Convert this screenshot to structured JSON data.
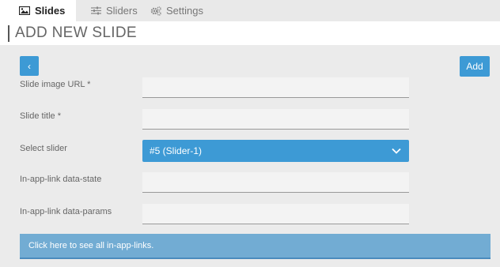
{
  "tabs": [
    {
      "label": "Slides",
      "icon": "image-icon",
      "active": true
    },
    {
      "label": "Sliders",
      "icon": "sliders-icon",
      "active": false
    },
    {
      "label": "Settings",
      "icon": "gears-icon",
      "active": false
    }
  ],
  "page": {
    "title": "ADD NEW SLIDE"
  },
  "toolbar": {
    "back_label": "‹",
    "add_label": "Add"
  },
  "form": {
    "image_url_label": "Slide image URL *",
    "image_url_value": "",
    "title_label": "Slide title *",
    "title_value": "",
    "slider_label": "Select slider",
    "slider_value": "#5 (Slider-1)",
    "data_state_label": "In-app-link data-state",
    "data_state_value": "",
    "data_params_label": "In-app-link data-params",
    "data_params_value": ""
  },
  "links_bar": {
    "label": "Click here to see all in-app-links."
  },
  "colors": {
    "accent": "#3d9ad5",
    "link_bar": "#72acd3",
    "background": "#ebebeb"
  }
}
